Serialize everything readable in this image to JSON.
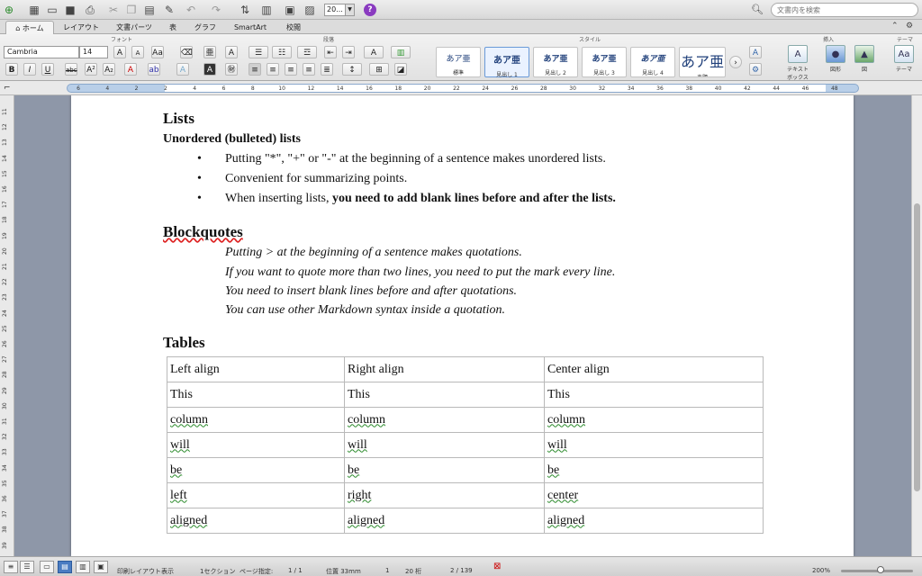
{
  "toolbar": {
    "font_size_value": "20...",
    "help_label": "?",
    "search_placeholder": "文書内を検索"
  },
  "tabs": [
    "ホーム",
    "レイアウト",
    "文書パーツ",
    "表",
    "グラフ",
    "SmartArt",
    "校閲"
  ],
  "ribbon": {
    "group_font": "フォント",
    "group_paragraph": "段落",
    "group_style": "スタイル",
    "group_insert": "挿入",
    "group_theme": "テーマ",
    "font_name": "Cambria",
    "font_size": "14",
    "styles": [
      {
        "sample": "あア亜",
        "name": "標準"
      },
      {
        "sample": "あア亜",
        "name": "見出し 1"
      },
      {
        "sample": "あア亜",
        "name": "見出し 2"
      },
      {
        "sample": "あア亜",
        "name": "見出し 3"
      },
      {
        "sample": "あア亜",
        "name": "見出し 4"
      },
      {
        "sample": "あア亜",
        "name": "表題"
      }
    ],
    "textbox_label": "テキスト\nボックス",
    "shape_label": "図形",
    "picture_label": "図",
    "theme_label": "テーマ"
  },
  "ruler_numbers": [
    "6",
    "4",
    "2",
    "2",
    "4",
    "6",
    "8",
    "10",
    "12",
    "14",
    "16",
    "18",
    "20",
    "22",
    "24",
    "26",
    "28",
    "30",
    "32",
    "34",
    "36",
    "38",
    "40",
    "42",
    "44",
    "46",
    "48"
  ],
  "vruler_numbers": [
    "11",
    "12",
    "13",
    "14",
    "15",
    "16",
    "17",
    "18",
    "19",
    "20",
    "21",
    "22",
    "23",
    "24",
    "25",
    "26",
    "27",
    "28",
    "29",
    "30",
    "31",
    "32",
    "33",
    "34",
    "35",
    "36",
    "37",
    "38",
    "39",
    "40"
  ],
  "document": {
    "lists_heading": "Lists",
    "unordered_heading": "Unordered (bulleted) lists",
    "bullets": [
      {
        "text": "Putting \"*\", \"+\" or \"-\" at the beginning of a sentence makes unordered lists.",
        "bold": ""
      },
      {
        "text": "Convenient for summarizing points.",
        "bold": ""
      },
      {
        "text": "When inserting lists, ",
        "bold": "you need to add blank lines before and after the lists."
      }
    ],
    "blockquotes_heading": "Blockquotes",
    "quotes": [
      "Putting > at the beginning of a sentence makes quotations.",
      "If you want to quote more than two lines, you need to put the mark every line.",
      "You need to insert blank lines before and after quotations.",
      "You can use other Markdown syntax inside a quotation."
    ],
    "tables_heading": "Tables",
    "table": {
      "headers": [
        "Left align",
        "Right align",
        "Center align"
      ],
      "rows": [
        [
          "This",
          "This",
          "This"
        ],
        [
          "column",
          "column",
          "column"
        ],
        [
          "will",
          "will",
          "will"
        ],
        [
          "be",
          "be",
          "be"
        ],
        [
          "left",
          "right",
          "center"
        ],
        [
          "aligned",
          "aligned",
          "aligned"
        ]
      ]
    }
  },
  "statusbar": {
    "view_mode": "印刷レイアウト表示",
    "section": "1セクション",
    "page_label": "ページ指定:",
    "page_value": "1 / 1",
    "position": "位置 33mm",
    "line": "1",
    "column": "20 桁",
    "pages": "2 / 139",
    "zoom": "200%"
  }
}
